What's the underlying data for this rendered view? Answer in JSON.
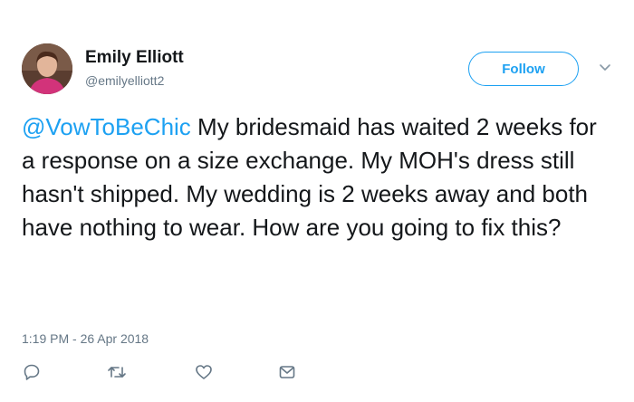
{
  "author": {
    "display_name": "Emily Elliott",
    "handle": "@emilyelliott2"
  },
  "header": {
    "follow_label": "Follow"
  },
  "tweet": {
    "mention": "@VowToBeChic",
    "body": " My bridesmaid has waited 2 weeks for a response on a size exchange. My MOH's dress still hasn't shipped. My wedding is 2 weeks away and both have nothing to wear. How are you going to fix this?",
    "timestamp": "1:19 PM - 26 Apr 2018"
  },
  "actions": {
    "icons": [
      "reply-icon",
      "retweet-icon",
      "like-icon",
      "direct-message-icon"
    ]
  },
  "colors": {
    "accent": "#1da1f2",
    "text": "#14171a",
    "secondary": "#657786"
  }
}
